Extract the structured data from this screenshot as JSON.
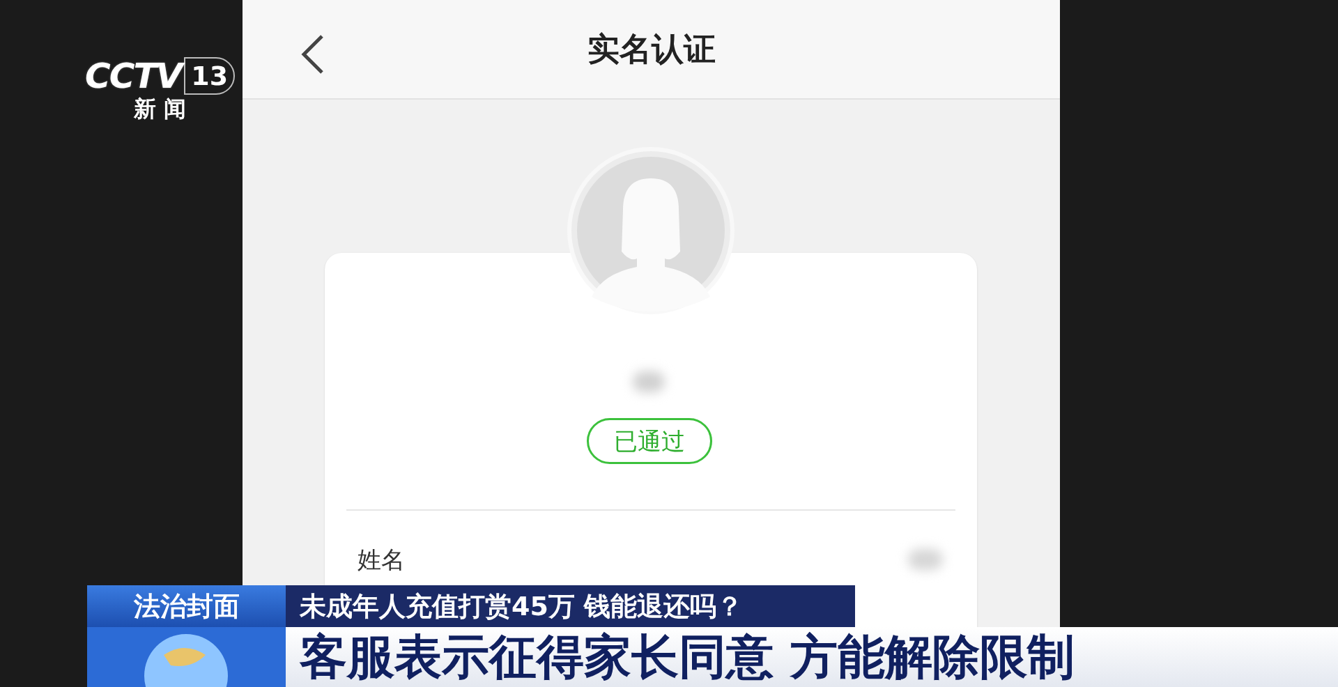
{
  "broadcast_logo": {
    "channel": "CCTV",
    "number": "13",
    "subtitle": "新 闻"
  },
  "phone_screen": {
    "title": "实名认证",
    "status_badge": "已通过",
    "fields": [
      {
        "label": "姓名"
      }
    ]
  },
  "lower_third": {
    "program": "法治封面",
    "headline": "未成年人充值打赏45万 钱能退还吗？",
    "caption": "客服表示征得家长同意 方能解除限制"
  }
}
